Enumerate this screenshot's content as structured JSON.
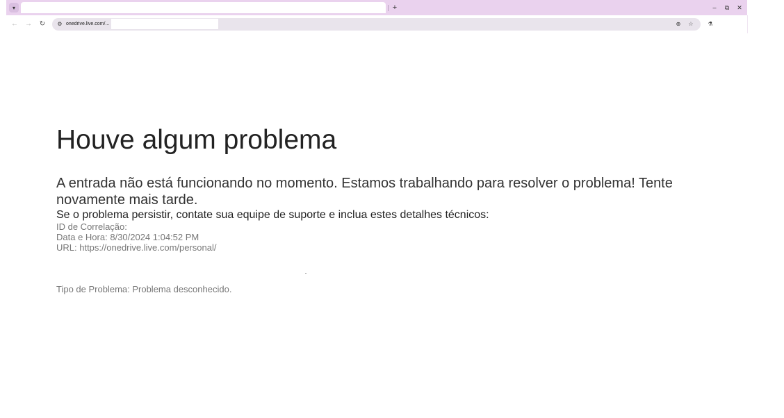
{
  "browser": {
    "tab_search_icon": "chevron-down-icon",
    "new_tab_label": "+",
    "window_controls": {
      "minimize": "–",
      "maximize": "⧉",
      "close": "✕"
    },
    "nav": {
      "back": "←",
      "forward": "→",
      "reload": "↻"
    },
    "url": "onedrive.live.com/...",
    "site_info_glyph": "⚙",
    "zoom_glyph": "⊕",
    "star_glyph": "☆",
    "labs_glyph": "⚗"
  },
  "error_page": {
    "title": "Houve algum problema",
    "message": "A entrada não está funcionando no momento. Estamos trabalhando para resolver o problema! Tente novamente mais tarde.",
    "support_text": "Se o problema persistir, contate sua equipe de suporte e inclua estes detalhes técnicos:",
    "details": {
      "correlation_id": "ID de Correlação:",
      "date_time": "Data e Hora: 8/30/2024 1:04:52 PM",
      "url": "URL: https://onedrive.live.com/personal/",
      "problem_type": "Tipo de Problema: Problema desconhecido."
    }
  }
}
